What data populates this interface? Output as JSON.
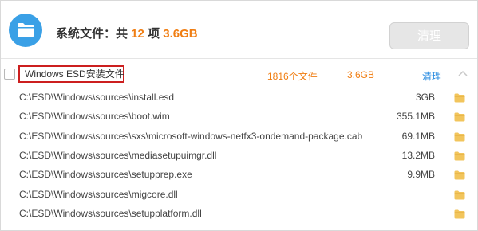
{
  "header": {
    "title_prefix": "系统文件：共",
    "count": "12",
    "unit": "项",
    "total_size": "3.6GB",
    "clean_label": "清理",
    "icon": "folder-icon"
  },
  "group": {
    "name": "Windows ESD安装文件",
    "count": "1816个文件",
    "size": "3.6GB",
    "clean_label": "清理",
    "collapse_icon": "chevron-up-icon"
  },
  "files": [
    {
      "path": "C:\\ESD\\Windows\\sources\\install.esd",
      "size": "3GB"
    },
    {
      "path": "C:\\ESD\\Windows\\sources\\boot.wim",
      "size": "355.1MB"
    },
    {
      "path": "C:\\ESD\\Windows\\sources\\sxs\\microsoft-windows-netfx3-ondemand-package.cab",
      "size": "69.1MB"
    },
    {
      "path": "C:\\ESD\\Windows\\sources\\mediasetupuimgr.dll",
      "size": "13.2MB"
    },
    {
      "path": "C:\\ESD\\Windows\\sources\\setupprep.exe",
      "size": "9.9MB"
    },
    {
      "path": "C:\\ESD\\Windows\\sources\\migcore.dll",
      "size": ""
    },
    {
      "path": "C:\\ESD\\Windows\\sources\\setupplatform.dll",
      "size": ""
    }
  ],
  "colors": {
    "accent_orange": "#f07e13",
    "link_blue": "#2a8ce0",
    "folder_blue": "#3aa0e6",
    "folder_yellow": "#f2c55c",
    "highlight_red": "#cc1f1f"
  }
}
